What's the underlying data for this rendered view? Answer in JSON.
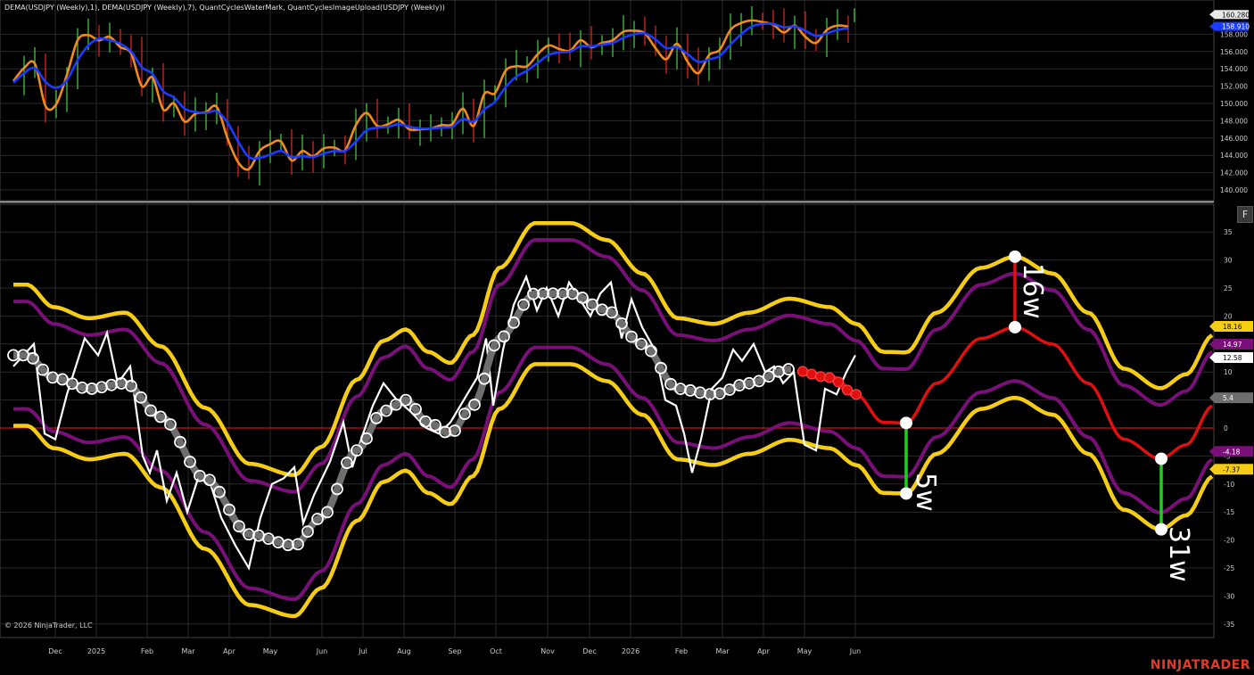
{
  "title_text": "DEMA(USDJPY (Weekly),1), DEMA(USDJPY (Weekly),7), QuantCyclesWaterMark, QuantCyclesImageUpload(USDJPY (Weekly))",
  "copyright": "© 2026 NinjaTrader, LLC",
  "brand": "NINJATRADER",
  "f_button": "F",
  "colors": {
    "background": "#000000",
    "grid": "#2a2a2a",
    "yellow": "#f5cc16",
    "purple": "#7a0f7a",
    "red": "#e01010",
    "green": "#22cc22",
    "gray": "#6e6e6e",
    "white": "#ffffff",
    "orange": "#f08a1d",
    "blue": "#1a3cff",
    "zero_line": "#c01818"
  },
  "chart_data": [
    {
      "type": "line",
      "name": "price-panel",
      "x_tick_labels": [
        "Dec",
        "2025",
        "Feb",
        "Mar",
        "Apr",
        "May",
        "Jun",
        "Jul",
        "Aug",
        "Sep",
        "Oct",
        "Nov",
        "Dec",
        "2026",
        "Feb",
        "Mar",
        "Apr",
        "May",
        "Jun"
      ],
      "y_ticks": [
        "140.000",
        "142.000",
        "144.000",
        "146.000",
        "148.000",
        "150.000",
        "152.000",
        "154.000",
        "156.000",
        "158.000"
      ],
      "ylim": [
        139.0,
        161.0
      ],
      "series": [
        {
          "name": "DEMA(USDJPY (Weekly),1)",
          "color": "#f08a1d",
          "values": [
            152.6,
            154.1,
            154.6,
            149.7,
            149.9,
            153.3,
            157.3,
            157.9,
            157.3,
            157.7,
            156.5,
            155.8,
            152.0,
            153.0,
            149.3,
            150.0,
            147.9,
            148.8,
            149.0,
            149.6,
            146.0,
            143.2,
            142.4,
            144.5,
            145.3,
            145.6,
            143.4,
            144.5,
            143.9,
            144.8,
            144.9,
            144.6,
            147.5,
            148.9,
            147.4,
            147.6,
            148.1,
            147.0,
            147.0,
            147.1,
            147.5,
            147.6,
            149.4,
            147.4,
            151.1,
            151.2,
            153.8,
            154.3,
            154.3,
            155.7,
            156.7,
            156.3,
            156.1,
            157.3,
            156.5,
            157.0,
            157.3,
            158.3,
            158.4,
            158.1,
            156.4,
            155.1,
            156.9,
            154.8,
            153.5,
            155.6,
            156.2,
            158.5,
            159.3,
            159.6,
            159.4,
            159.1,
            158.2,
            159.0,
            157.7,
            157.0,
            158.5,
            159.0,
            158.9
          ]
        },
        {
          "name": "DEMA(USDJPY (Weekly),7)",
          "color": "#1a3cff",
          "values": [
            152.4,
            153.5,
            154.1,
            152.5,
            151.8,
            152.7,
            155.0,
            156.7,
            157.5,
            157.3,
            156.9,
            156.0,
            154.2,
            153.4,
            151.4,
            150.7,
            149.4,
            149.0,
            148.9,
            149.1,
            147.8,
            145.6,
            143.8,
            143.7,
            144.1,
            144.5,
            143.8,
            143.9,
            143.8,
            144.2,
            144.5,
            144.5,
            145.6,
            146.9,
            147.2,
            147.3,
            147.6,
            147.3,
            147.1,
            147.1,
            147.2,
            147.3,
            148.2,
            147.9,
            149.3,
            150.2,
            151.9,
            153.1,
            153.8,
            154.7,
            155.6,
            155.9,
            156.0,
            156.6,
            156.6,
            156.8,
            157.0,
            157.6,
            158.0,
            158.1,
            157.4,
            156.4,
            156.5,
            155.7,
            154.8,
            155.1,
            155.5,
            156.8,
            158.0,
            158.9,
            159.2,
            159.2,
            158.8,
            158.9,
            158.4,
            157.8,
            158.1,
            158.5,
            158.7
          ]
        }
      ],
      "price_labels": [
        {
          "value": "160.280",
          "color": "#dddddd"
        },
        {
          "value": "158.910",
          "color": "#1a3cff"
        }
      ]
    },
    {
      "type": "line",
      "name": "cycles-panel",
      "x_tick_labels": [
        "Dec",
        "2025",
        "Feb",
        "Mar",
        "Apr",
        "May",
        "Jun",
        "Jul",
        "Aug",
        "Sep",
        "Oct",
        "Nov",
        "Dec",
        "2026",
        "Feb",
        "Mar",
        "Apr",
        "May",
        "Jun"
      ],
      "y_ticks": [
        "35",
        "30",
        "25",
        "20",
        "15",
        "10",
        "5",
        "0",
        "-5",
        "-10",
        "-15",
        "-20",
        "-25",
        "-30",
        "-35"
      ],
      "ylim": [
        -36,
        37
      ],
      "value_labels": [
        {
          "value": "18.16",
          "color": "#f5cc16"
        },
        {
          "value": "14.97",
          "color": "#7a0f7a"
        },
        {
          "value": "12.58",
          "color": "#ffffff"
        },
        {
          "value": "5.4",
          "color": "#6e6e6e"
        },
        {
          "value": "-4.18",
          "color": "#7a0f7a"
        },
        {
          "value": "-7.37",
          "color": "#f5cc16"
        }
      ],
      "cycle_annotations": [
        "5w",
        "16w",
        "31w"
      ]
    }
  ]
}
